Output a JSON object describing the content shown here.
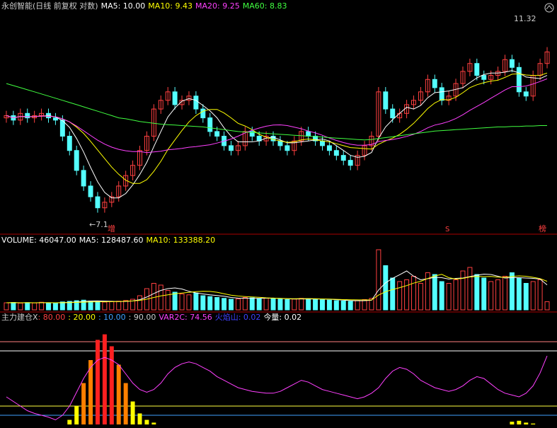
{
  "colors": {
    "bg": "#000000",
    "up": "#ff4040",
    "down": "#54ffff",
    "ma5": "#ffffff",
    "ma10": "#ffff00",
    "ma20": "#ff40ff",
    "ma60": "#40ff40",
    "divider": "#aa0000",
    "vol_label": "#ffffff",
    "ind_label1": "#ff4040",
    "ind_label2": "#ffff00",
    "ind_label3": "#ffffff",
    "ind_label4": "#40a0ff",
    "ind_label5": "#ff40ff",
    "ind_label6": "#4040ff"
  },
  "price_header": {
    "title": "永创智能(日线 前复权 对数)",
    "ma5": "MA5: 10.00",
    "ma10": "MA10: 9.43",
    "ma20": "MA20: 9.25",
    "ma60": "MA60: 8.83"
  },
  "price_labels": {
    "high": "11.32",
    "low": "7.1",
    "mark_zeng": "增",
    "mark_s": "S",
    "mark_bang": "榜"
  },
  "volume_header": {
    "volume": "VOLUME: 46047.00",
    "ma5": "MA5: 128487.60",
    "ma10": "MA10: 133388.20"
  },
  "indicator_header": {
    "name": "主力建仓X",
    "l80": ": 80.00",
    "l20": ": 20.00",
    "l10": ": 10.00",
    "l90": ": 90.00",
    "var2c": "VAR2C: 74.56",
    "volcano": "火焰山: 0.02",
    "today": "今量: 0.02"
  },
  "chart_data": {
    "type": "candlestick",
    "price": {
      "scale": "log",
      "ylim": [
        6.9,
        11.6
      ],
      "high": 11.32,
      "low": 7.1,
      "open": [
        9.0,
        9.05,
        8.95,
        9.1,
        9.0,
        9.05,
        9.1,
        9.0,
        8.95,
        8.6,
        8.3,
        7.9,
        7.6,
        7.4,
        7.2,
        7.3,
        7.4,
        7.6,
        7.8,
        8.0,
        8.3,
        8.6,
        9.2,
        9.4,
        9.6,
        9.3,
        9.4,
        9.5,
        9.2,
        9.0,
        8.7,
        8.6,
        8.4,
        8.3,
        8.4,
        8.7,
        8.6,
        8.5,
        8.6,
        8.5,
        8.4,
        8.3,
        8.5,
        8.7,
        8.6,
        8.5,
        8.4,
        8.3,
        8.2,
        8.1,
        8.0,
        8.2,
        8.4,
        8.6,
        9.6,
        9.2,
        9.0,
        9.1,
        9.3,
        9.4,
        9.6,
        9.9,
        9.7,
        9.4,
        9.5,
        9.8,
        10.1,
        10.3,
        10.0,
        9.9,
        10.0,
        10.1,
        10.4,
        10.2,
        9.6,
        9.5,
        10.0,
        10.3
      ],
      "close": [
        9.05,
        8.95,
        9.1,
        9.0,
        9.05,
        9.1,
        9.0,
        8.95,
        8.6,
        8.3,
        7.9,
        7.6,
        7.4,
        7.2,
        7.3,
        7.4,
        7.6,
        7.8,
        8.0,
        8.3,
        8.6,
        9.2,
        9.4,
        9.6,
        9.3,
        9.4,
        9.5,
        9.2,
        9.0,
        8.7,
        8.6,
        8.4,
        8.3,
        8.4,
        8.7,
        8.6,
        8.5,
        8.6,
        8.5,
        8.4,
        8.3,
        8.5,
        8.7,
        8.6,
        8.5,
        8.4,
        8.3,
        8.2,
        8.1,
        8.0,
        8.2,
        8.4,
        8.6,
        9.6,
        9.2,
        9.0,
        9.1,
        9.3,
        9.4,
        9.6,
        9.9,
        9.7,
        9.4,
        9.5,
        9.8,
        10.1,
        10.3,
        10.0,
        9.9,
        10.0,
        10.1,
        10.4,
        10.2,
        9.6,
        9.5,
        10.0,
        10.3,
        10.6
      ],
      "ma60_trend": [
        9.8,
        9.75,
        9.7,
        9.65,
        9.6,
        9.55,
        9.5,
        9.45,
        9.4,
        9.35,
        9.3,
        9.25,
        9.2,
        9.15,
        9.1,
        9.05,
        9.0,
        8.98,
        8.95,
        8.92,
        8.9,
        8.88,
        8.86,
        8.85,
        8.84,
        8.83,
        8.82,
        8.81,
        8.8,
        8.78,
        8.76,
        8.74,
        8.72,
        8.7,
        8.69,
        8.68,
        8.67,
        8.66,
        8.65,
        8.64,
        8.63,
        8.62,
        8.61,
        8.6,
        8.59,
        8.58,
        8.57,
        8.56,
        8.55,
        8.54,
        8.53,
        8.52,
        8.53,
        8.55,
        8.57,
        8.59,
        8.61,
        8.63,
        8.65,
        8.67,
        8.69,
        8.71,
        8.72,
        8.73,
        8.74,
        8.75,
        8.76,
        8.77,
        8.78,
        8.79,
        8.8,
        8.8,
        8.81,
        8.81,
        8.82,
        8.82,
        8.83,
        8.83
      ]
    },
    "volume": {
      "ylim": [
        0,
        360000
      ],
      "values": [
        40000,
        42000,
        38000,
        41000,
        39000,
        43000,
        40000,
        37000,
        45000,
        48000,
        52000,
        55000,
        50000,
        47000,
        44000,
        46000,
        49000,
        53000,
        60000,
        80000,
        120000,
        150000,
        140000,
        110000,
        100000,
        90000,
        85000,
        95000,
        80000,
        75000,
        70000,
        65000,
        60000,
        62000,
        70000,
        68000,
        64000,
        66000,
        63000,
        60000,
        58000,
        61000,
        65000,
        63000,
        60000,
        57000,
        55000,
        52000,
        50000,
        48000,
        52000,
        58000,
        65000,
        340000,
        250000,
        180000,
        160000,
        170000,
        190000,
        150000,
        210000,
        200000,
        160000,
        150000,
        170000,
        220000,
        240000,
        200000,
        180000,
        160000,
        170000,
        190000,
        210000,
        180000,
        150000,
        160000,
        170000,
        46047
      ]
    },
    "indicator": {
      "levels": {
        "l80": 80,
        "l20": 20,
        "l10": 10,
        "l90": 90
      },
      "var2c_last": 74.56,
      "volcano_last": 0.02,
      "today_last": 0.02,
      "ylim": [
        0,
        100
      ],
      "var2c": [
        30,
        25,
        20,
        15,
        12,
        10,
        8,
        5,
        10,
        20,
        35,
        50,
        62,
        70,
        73,
        70,
        65,
        55,
        45,
        38,
        35,
        38,
        45,
        55,
        62,
        66,
        68,
        66,
        62,
        58,
        52,
        48,
        44,
        40,
        38,
        36,
        35,
        34,
        34,
        36,
        40,
        44,
        48,
        46,
        42,
        38,
        36,
        34,
        32,
        30,
        28,
        30,
        34,
        40,
        50,
        58,
        62,
        60,
        55,
        48,
        44,
        40,
        38,
        36,
        38,
        42,
        48,
        52,
        50,
        44,
        38,
        34,
        32,
        30,
        34,
        42,
        56,
        74.56
      ],
      "volcano": [
        0,
        0,
        0,
        0,
        0,
        0,
        0,
        0,
        0,
        5,
        20,
        45,
        70,
        92,
        98,
        85,
        65,
        45,
        25,
        12,
        5,
        2,
        0,
        0,
        0,
        0,
        0,
        0,
        0,
        0,
        0,
        0,
        0,
        0,
        0,
        0,
        0,
        0,
        0,
        0,
        0,
        0,
        0,
        0,
        0,
        0,
        0,
        0,
        0,
        0,
        0,
        0,
        0,
        0,
        0,
        0,
        0,
        0,
        0,
        0,
        0,
        0,
        0,
        0,
        0,
        0,
        0,
        0,
        0,
        0,
        0,
        0,
        3,
        4,
        2,
        1,
        0,
        0.02
      ]
    }
  }
}
